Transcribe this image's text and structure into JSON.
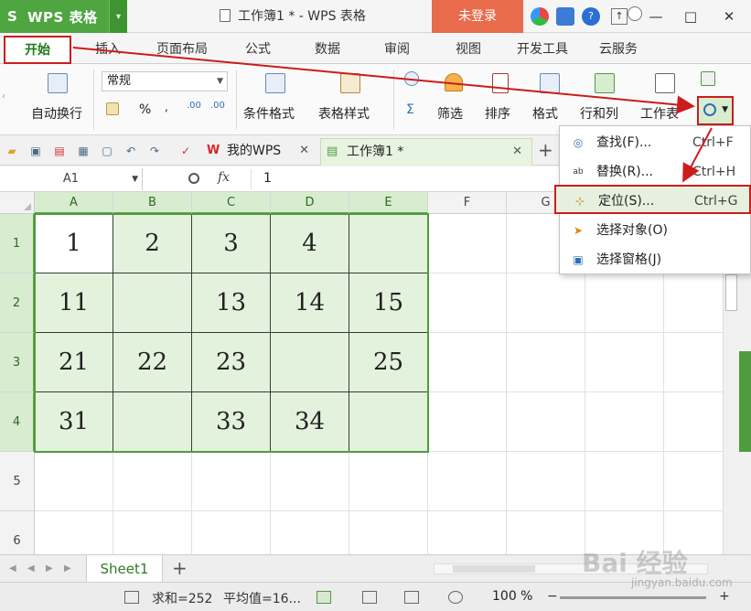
{
  "titlebar": {
    "app_logo": "S",
    "app_name": "WPS 表格",
    "doc_title": "工作簿1 * - WPS 表格",
    "login": "未登录",
    "caret": "▾"
  },
  "ribbon_tabs": [
    {
      "label": "开始"
    },
    {
      "label": "插入"
    },
    {
      "label": "页面布局"
    },
    {
      "label": "公式"
    },
    {
      "label": "数据"
    },
    {
      "label": "审阅"
    },
    {
      "label": "视图"
    },
    {
      "label": "开发工具"
    },
    {
      "label": "云服务"
    }
  ],
  "ribbon": {
    "wrap_text": "自动换行",
    "number_format": "常规",
    "percent": "%",
    "conditional_format": "条件格式",
    "table_style": "表格样式",
    "sum": "Σ",
    "filter": "筛选",
    "sort": "排序",
    "format": "格式",
    "rows_cols": "行和列",
    "worksheet": "工作表",
    "dec_inc": ".00",
    "dec_dec": ".00"
  },
  "doc_tabs": [
    {
      "label": "我的WPS"
    },
    {
      "label": "工作簿1 *"
    }
  ],
  "formula_bar": {
    "name_box": "A1",
    "fx": "fx",
    "value": "1"
  },
  "columns": [
    "A",
    "B",
    "C",
    "D",
    "E",
    "F",
    "G"
  ],
  "rows": [
    {
      "num": "1",
      "cells": [
        "1",
        "2",
        "3",
        "4",
        ""
      ]
    },
    {
      "num": "2",
      "cells": [
        "11",
        "",
        "13",
        "14",
        "15"
      ]
    },
    {
      "num": "3",
      "cells": [
        "21",
        "22",
        "23",
        "",
        "25"
      ]
    },
    {
      "num": "4",
      "cells": [
        "31",
        "",
        "33",
        "34",
        ""
      ]
    },
    {
      "num": "5",
      "cells": [
        "",
        "",
        "",
        "",
        ""
      ]
    },
    {
      "num": "6",
      "cells": [
        "",
        "",
        "",
        "",
        ""
      ]
    }
  ],
  "sheet": {
    "tab": "Sheet1",
    "add": "+"
  },
  "status": {
    "sum": "求和=252",
    "avg": "平均值=16...",
    "zoom": "100 %",
    "minus": "−",
    "plus": "+"
  },
  "menu": [
    {
      "label": "查找(F)...",
      "shortcut": "Ctrl+F",
      "icon": "find-icon"
    },
    {
      "label": "替换(R)...",
      "shortcut": "Ctrl+H",
      "icon": "replace-icon"
    },
    {
      "label": "定位(S)...",
      "shortcut": "Ctrl+G",
      "icon": "goto-icon"
    },
    {
      "label": "选择对象(O)",
      "shortcut": "",
      "icon": "select-objects-icon"
    },
    {
      "label": "选择窗格(J)",
      "shortcut": "",
      "icon": "selection-pane-icon"
    }
  ],
  "watermark": {
    "text": "Bai 经验",
    "url": "jingyan.baidu.com"
  },
  "colors": {
    "accent_green": "#4fa540",
    "annotation_red": "#cc1c1c",
    "selection_fill": "#e3f2dc"
  }
}
